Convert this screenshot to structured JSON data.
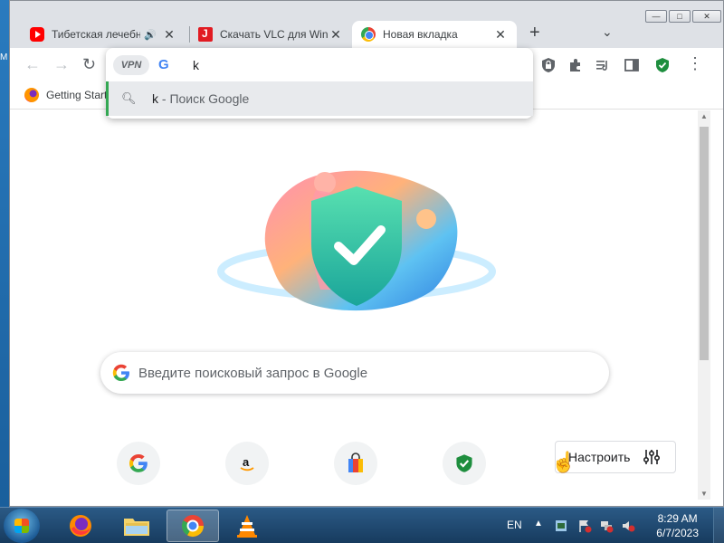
{
  "desktop": {
    "edge_label": "M"
  },
  "window_controls": {
    "minimize": "—",
    "maximize": "□",
    "close": "✕"
  },
  "tabs": [
    {
      "title": "Тибетская лечебн",
      "favicon": "youtube-icon",
      "audio": true,
      "active": false
    },
    {
      "title": "Скачать VLC для Wind",
      "favicon": "vlc-site-icon",
      "active": false
    },
    {
      "title": "Новая вкладка",
      "favicon": "chrome-icon",
      "active": true
    }
  ],
  "toolbar": {
    "back": "←",
    "forward": "→",
    "reload": "↻",
    "new_tab": "+",
    "tab_search": "⌄",
    "menu": "⋮"
  },
  "omnibox": {
    "vpn_badge": "VPN",
    "engine_letter": "G",
    "value": "k",
    "suggestion": {
      "query": "k",
      "suffix": " - Поиск Google"
    }
  },
  "bookmarks": [
    {
      "label": "Getting Started",
      "icon": "firefox-icon"
    }
  ],
  "page": {
    "search_placeholder": "Введите поисковый запрос в Google",
    "customize_label": "Настроить",
    "shortcuts": [
      {
        "name": "google",
        "icon": "google-icon"
      },
      {
        "name": "amazon",
        "icon": "amazon-icon"
      },
      {
        "name": "shopping",
        "icon": "shopping-bag-icon"
      },
      {
        "name": "shield",
        "icon": "shield-check-icon"
      }
    ]
  },
  "taskbar": {
    "apps": [
      "firefox",
      "file-explorer",
      "chrome",
      "vlc"
    ],
    "language": "EN",
    "time": "8:29 AM",
    "date": "6/7/2023"
  },
  "colors": {
    "accent_green": "#34a853",
    "google_blue": "#4285f4",
    "taskbar": "#1f4a72"
  }
}
